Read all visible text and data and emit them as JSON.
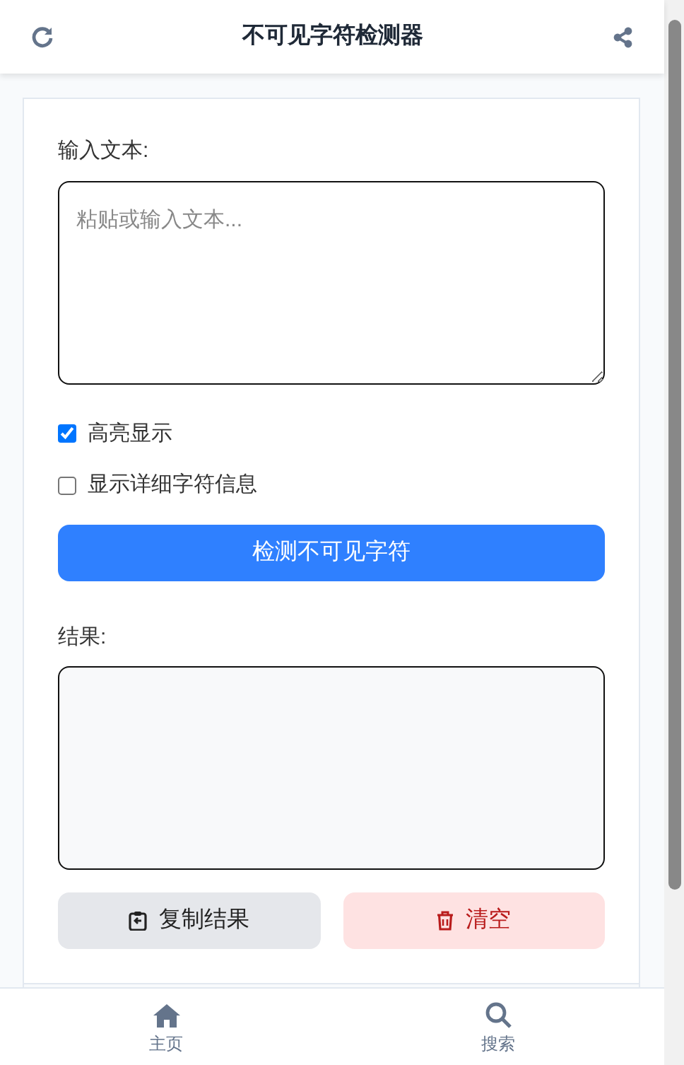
{
  "header": {
    "title": "不可见字符检测器"
  },
  "input": {
    "label": "输入文本:",
    "placeholder": "粘贴或输入文本..."
  },
  "options": [
    {
      "label": "高亮显示",
      "checked": true
    },
    {
      "label": "显示详细字符信息",
      "checked": false
    }
  ],
  "detect_button": "检测不可见字符",
  "result": {
    "label": "结果:"
  },
  "actions": [
    {
      "kind": "copy",
      "label": "复制结果"
    },
    {
      "kind": "clear",
      "label": "清空"
    }
  ],
  "bottom_nav": [
    {
      "kind": "home",
      "label": "主页"
    },
    {
      "kind": "search",
      "label": "搜索"
    }
  ]
}
